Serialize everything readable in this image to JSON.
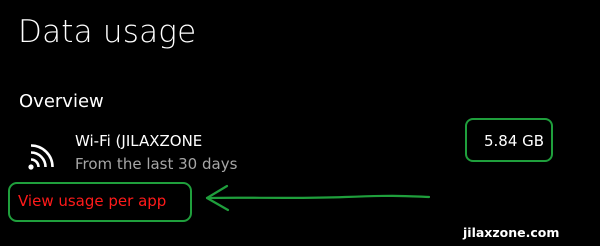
{
  "page": {
    "title": "Data usage"
  },
  "overview": {
    "header": "Overview",
    "network": {
      "icon": "wifi-icon",
      "name": "Wi-Fi (JILAXZONE",
      "period": "From the last 30 days",
      "usage": "5.84 GB"
    },
    "link_label": "View usage per app"
  },
  "annotations": {
    "highlight_color": "#1f9f3c",
    "link_color": "#ff1a1a",
    "watermark": "jilaxzone.com"
  }
}
